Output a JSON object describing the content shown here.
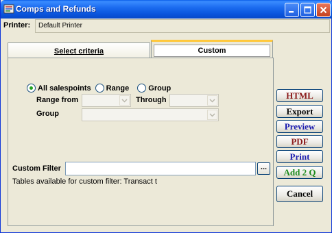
{
  "window": {
    "title": "Comps and Refunds",
    "title_icon": "report-icon"
  },
  "printer": {
    "label": "Printer:",
    "value": "Default Printer"
  },
  "tabs": [
    {
      "label": "Select criteria"
    },
    {
      "label": "Custom"
    }
  ],
  "salespoints": {
    "options": [
      {
        "label": "All salespoints",
        "selected": true
      },
      {
        "label": "Range",
        "selected": false
      },
      {
        "label": "Group",
        "selected": false
      }
    ],
    "range_from_label": "Range from",
    "through_label": "Through",
    "group_label": "Group",
    "range_from_value": "",
    "through_value": "",
    "group_value": ""
  },
  "custom_filter": {
    "label": "Custom Filter",
    "value": "",
    "browse_label": "...",
    "hint": "Tables available for custom filter: Transact t"
  },
  "buttons": {
    "html": {
      "label": "HTML",
      "color": "#8b1a1a"
    },
    "export": {
      "label": "Export",
      "color": "#000000"
    },
    "preview": {
      "label": "Preview",
      "color": "#1a1ab0"
    },
    "pdf": {
      "label": "PDF",
      "color": "#8b1a1a"
    },
    "print": {
      "label": "Print",
      "color": "#1a1ab0"
    },
    "add2q": {
      "label": "Add 2 Q",
      "color": "#1a8a1a"
    },
    "cancel": {
      "label": "Cancel",
      "color": "#000000"
    }
  }
}
